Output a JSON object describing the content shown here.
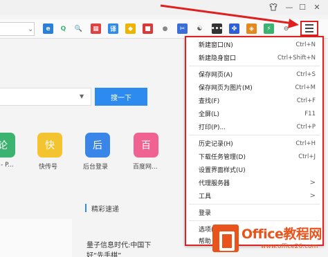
{
  "window": {
    "shirt_icon": "shirt-icon",
    "minimize": "—",
    "maximize": "☐",
    "close": "✕"
  },
  "toolbar": {
    "icons": [
      {
        "name": "ie-icon",
        "glyph": "e",
        "color": "#2a7fd8"
      },
      {
        "name": "search-tools-icon",
        "glyph": "Q",
        "color": "#3cb371"
      },
      {
        "name": "magnifier-icon",
        "glyph": "🔍",
        "color": "#ffffff"
      },
      {
        "name": "apps-icon",
        "glyph": "▦",
        "color": "#e04040"
      },
      {
        "name": "translate-icon",
        "glyph": "译",
        "color": "#2d8bf0"
      },
      {
        "name": "shield-icon",
        "glyph": "◆",
        "color": "#f0b400"
      },
      {
        "name": "save-icon",
        "glyph": "■",
        "color": "#d83a3a"
      },
      {
        "name": "globe-icon",
        "glyph": "●",
        "color": "#888888"
      },
      {
        "name": "screenshot-icon",
        "glyph": "✂",
        "color": "#3a6fd8"
      },
      {
        "name": "yinyang-icon",
        "glyph": "☯",
        "color": "#555555"
      },
      {
        "name": "more-icon",
        "glyph": "•••",
        "color": "#333333"
      },
      {
        "name": "baidu-icon",
        "glyph": "✤",
        "color": "#2d5fd8"
      },
      {
        "name": "wallet-icon",
        "glyph": "◈",
        "color": "#e08a20"
      },
      {
        "name": "battery-icon",
        "glyph": "⚡",
        "color": "#3cb371"
      },
      {
        "name": "link-icon",
        "glyph": "⊖",
        "color": "#777777"
      },
      {
        "name": "cross-icon",
        "glyph": "✗",
        "color": "#aaaaaa"
      }
    ]
  },
  "search": {
    "button": "搜一下"
  },
  "shortcuts": [
    {
      "glyph": "论",
      "label": "- P...",
      "color": "#3cb371"
    },
    {
      "glyph": "快",
      "label": "快传号",
      "color": "#f4c430"
    },
    {
      "glyph": "后",
      "label": "后台登录",
      "color": "#3a86e8"
    },
    {
      "glyph": "百",
      "label": "百度网...",
      "color": "#f06292"
    }
  ],
  "section": {
    "title": "精彩速递"
  },
  "news": {
    "line1": "量子信息时代:中国下",
    "line2": "好“先手棋”"
  },
  "menu": {
    "items": [
      {
        "label": "新建窗口(N)",
        "shortcut": "Ctrl+N"
      },
      {
        "label": "新建隐身窗口",
        "shortcut": "Ctrl+Shift+N"
      },
      {
        "label": "保存网页(A)",
        "shortcut": "Ctrl+S"
      },
      {
        "label": "保存网页为图片(M)",
        "shortcut": "Ctrl+M"
      },
      {
        "label": "查找(F)",
        "shortcut": "Ctrl+F"
      },
      {
        "label": "全屏(L)",
        "shortcut": "F11"
      },
      {
        "label": "打印(P)...",
        "shortcut": "Ctrl+P"
      },
      {
        "label": "历史记录(H)",
        "shortcut": "Ctrl+H"
      },
      {
        "label": "下载任务管理(D)",
        "shortcut": "Ctrl+J"
      },
      {
        "label": "设置界面样式(U)",
        "shortcut": ""
      },
      {
        "label": "代理服务器",
        "shortcut": ">"
      },
      {
        "label": "工具",
        "shortcut": ">"
      },
      {
        "label": "登录",
        "shortcut": ""
      },
      {
        "label": "选项(O)",
        "shortcut": ""
      },
      {
        "label": "帮助",
        "shortcut": ""
      }
    ]
  },
  "watermark": {
    "brand": "Office教程网",
    "url": "www.office26.com"
  }
}
